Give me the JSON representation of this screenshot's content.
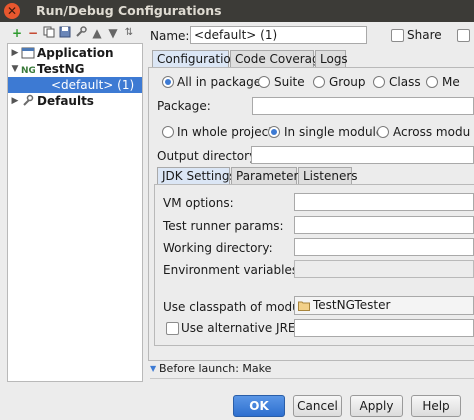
{
  "window": {
    "title": "Run/Debug Configurations"
  },
  "toolbar": {
    "icons": [
      "add-icon",
      "remove-icon",
      "copy-icon",
      "save-icon",
      "wrench-icon",
      "move-up-icon",
      "move-down-icon",
      "sort-icon"
    ]
  },
  "tree": {
    "items": [
      {
        "label": "Application",
        "bold": true
      },
      {
        "label": "TestNG",
        "bold": true
      },
      {
        "label": "<default> (1)",
        "selected": true
      },
      {
        "label": "Defaults",
        "bold": true
      }
    ]
  },
  "form": {
    "name_label": "Name:",
    "name_value": "<default> (1)",
    "share_label": "Share",
    "tabs": [
      "Configuration",
      "Code Coverage",
      "Logs"
    ],
    "scope_options": [
      "All in package",
      "Suite",
      "Group",
      "Class",
      "Me"
    ],
    "scope_selected": "All in package",
    "package_label": "Package:",
    "search_options": [
      "In whole project",
      "In single module",
      "Across modu"
    ],
    "search_selected": "In single module",
    "output_dir_label": "Output directory:",
    "subtabs": [
      "JDK Settings",
      "Parameters",
      "Listeners"
    ],
    "vm_options_label": "VM options:",
    "test_runner_label": "Test runner params:",
    "working_dir_label": "Working directory:",
    "env_vars_label": "Environment variables:",
    "classpath_label": "Use classpath of module:",
    "classpath_value": "TestNGTester",
    "alt_jre_label": "Use alternative JRE:",
    "before_launch": "Before launch: Make"
  },
  "buttons": {
    "ok": "OK",
    "cancel": "Cancel",
    "apply": "Apply",
    "help": "Help"
  },
  "colors": {
    "accent": "#3d7ad3",
    "titlebar": "#3c3b37",
    "close": "#e8572e"
  }
}
